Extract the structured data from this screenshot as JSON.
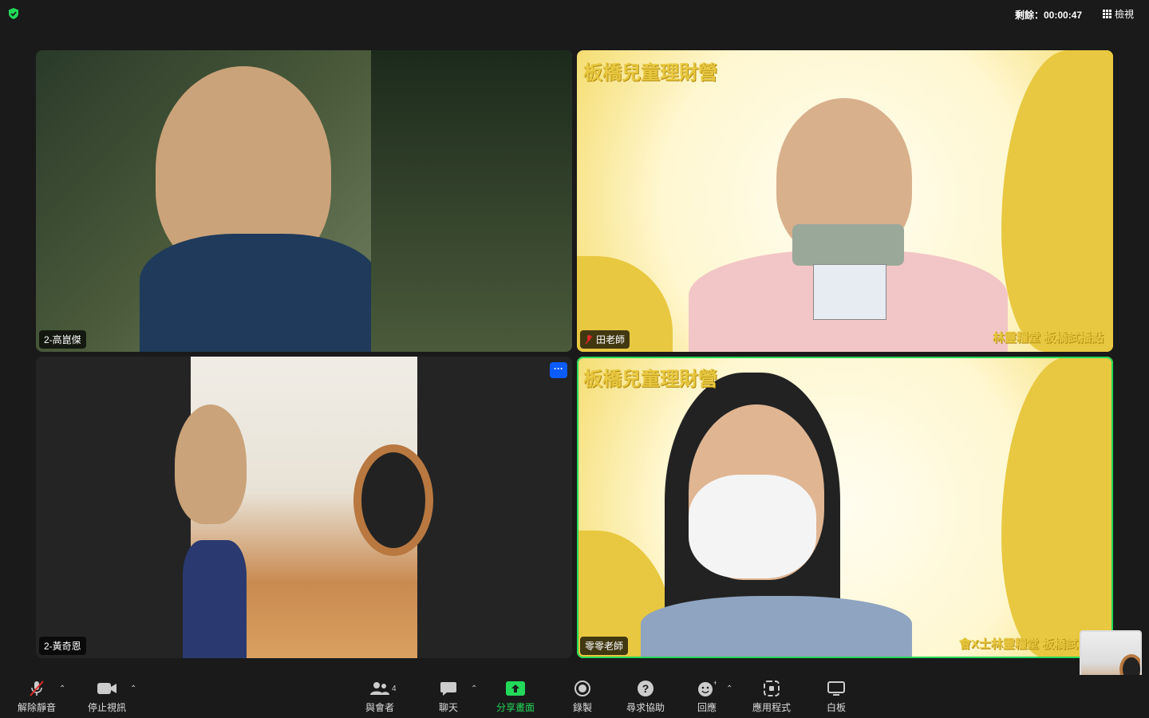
{
  "header": {
    "timer_label": "剩餘：00:00:47",
    "view_label": "檢視"
  },
  "participants": [
    {
      "name": "2-高崑傑"
    },
    {
      "name": "田老師"
    },
    {
      "name": "2-黃奇恩"
    },
    {
      "name": "零零老師"
    }
  ],
  "backgrounds": {
    "title": "板橋兒童理財營",
    "footer": "林靈糧堂 板橋試播點",
    "footer_alt": "會X士林靈糧堂 板橋試"
  },
  "toolbar": {
    "mute_label": "解除靜音",
    "video_label": "停止視訊",
    "participants_label": "與會者",
    "participants_count": "4",
    "chat_label": "聊天",
    "share_label": "分享畫面",
    "record_label": "錄製",
    "help_label": "尋求協助",
    "reactions_label": "回應",
    "apps_label": "應用程式",
    "whiteboard_label": "白板"
  },
  "colors": {
    "active_speaker": "#23d959",
    "share_green": "#23d959",
    "more_button": "#0b5cff"
  }
}
